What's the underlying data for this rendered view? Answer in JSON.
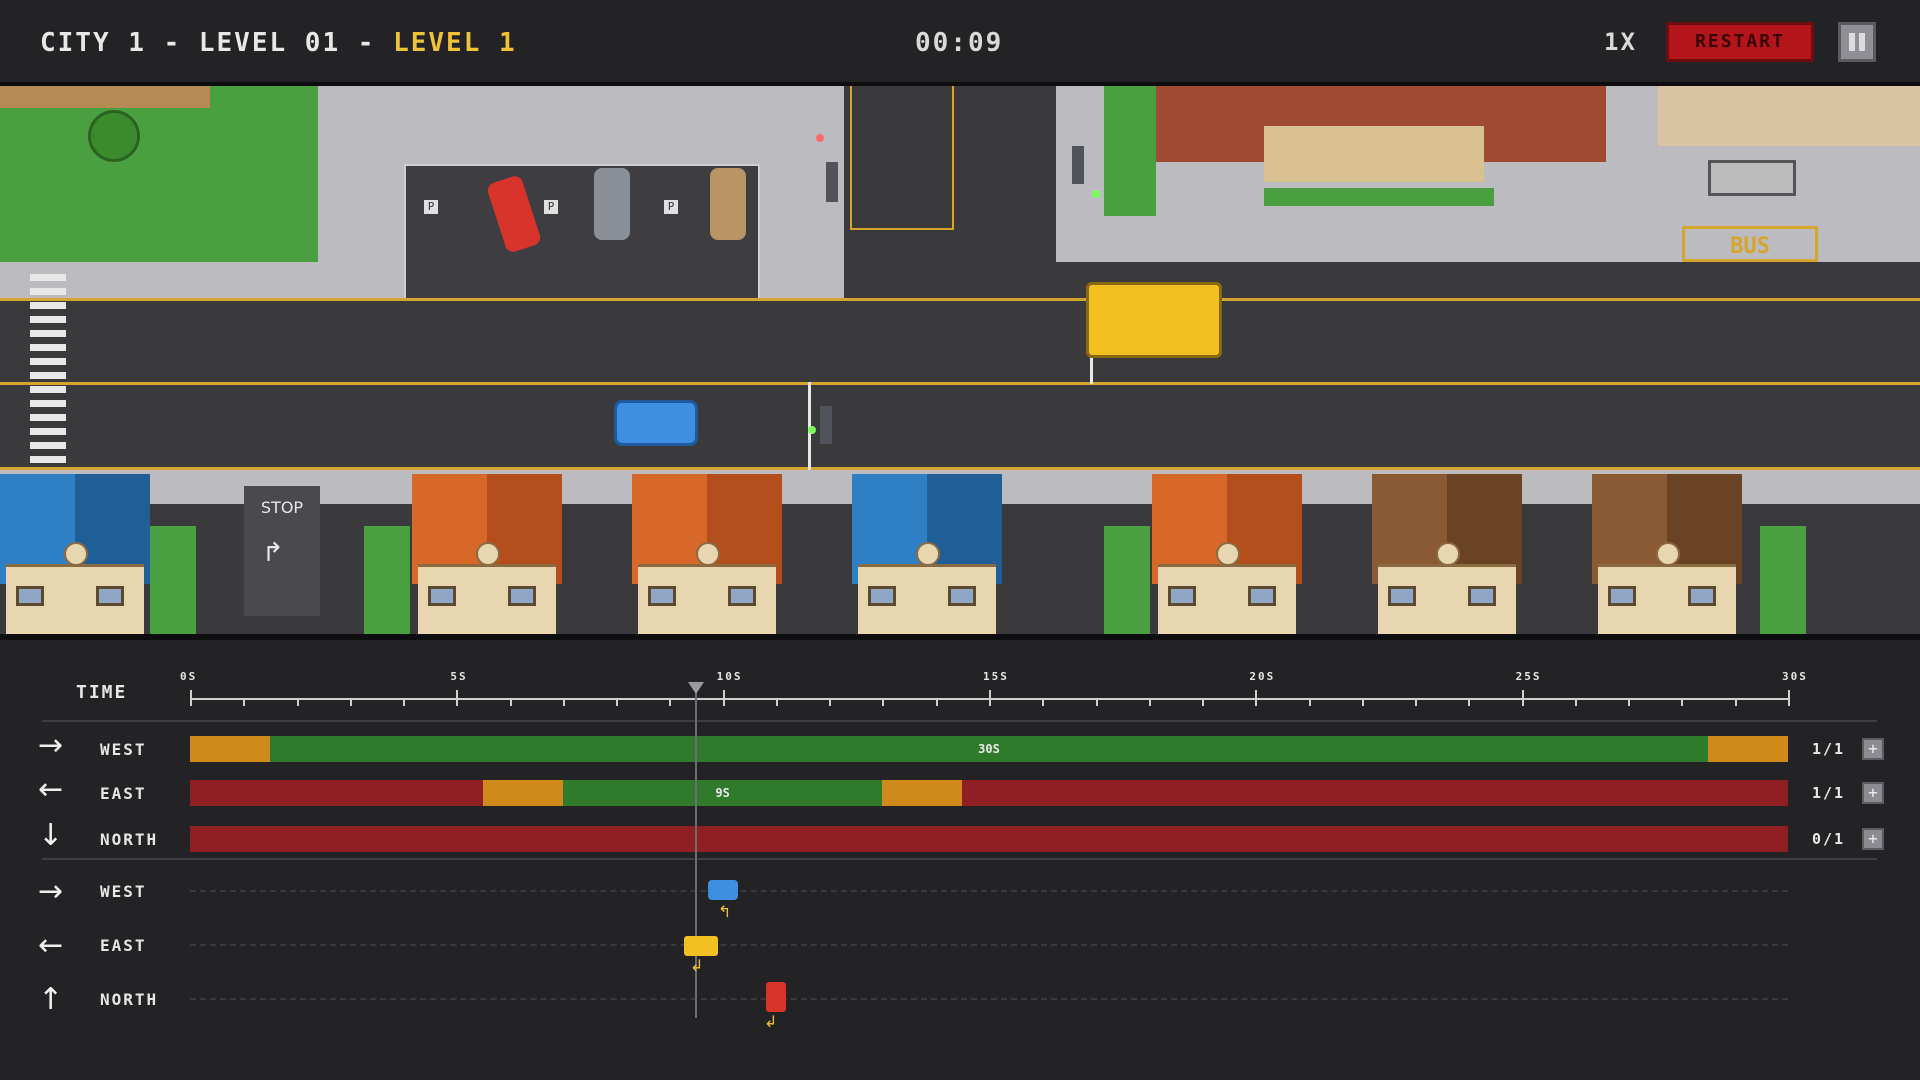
{
  "header": {
    "title_prefix": "CITY 1 - LEVEL 01 - ",
    "title_level": "LEVEL 1",
    "timer": "00:09",
    "speed": "1X",
    "restart_label": "RESTART"
  },
  "scene": {
    "bus_sign": "BUS",
    "stop_sign": "STOP",
    "parking_letter": "P"
  },
  "timeline": {
    "time_label": "TIME",
    "ticks": [
      "0S",
      "5S",
      "10S",
      "15S",
      "20S",
      "25S",
      "30S"
    ],
    "playhead_seconds": 9.5,
    "total_seconds": 30,
    "signals": [
      {
        "direction": "WEST",
        "arrow": "→",
        "count": "1/1",
        "green_label": "30S"
      },
      {
        "direction": "EAST",
        "arrow": "←",
        "count": "1/1",
        "green_label": "9S"
      },
      {
        "direction": "NORTH",
        "arrow": "↓",
        "count": "0/1",
        "green_label": ""
      }
    ],
    "vehicles": [
      {
        "direction": "WEST",
        "arrow": "→"
      },
      {
        "direction": "EAST",
        "arrow": "←"
      },
      {
        "direction": "NORTH",
        "arrow": "↑"
      }
    ]
  },
  "colors": {
    "green": "#2f7a2b",
    "red": "#8f1f22",
    "amber": "#d08a1c",
    "title_accent": "#f0c23a"
  }
}
